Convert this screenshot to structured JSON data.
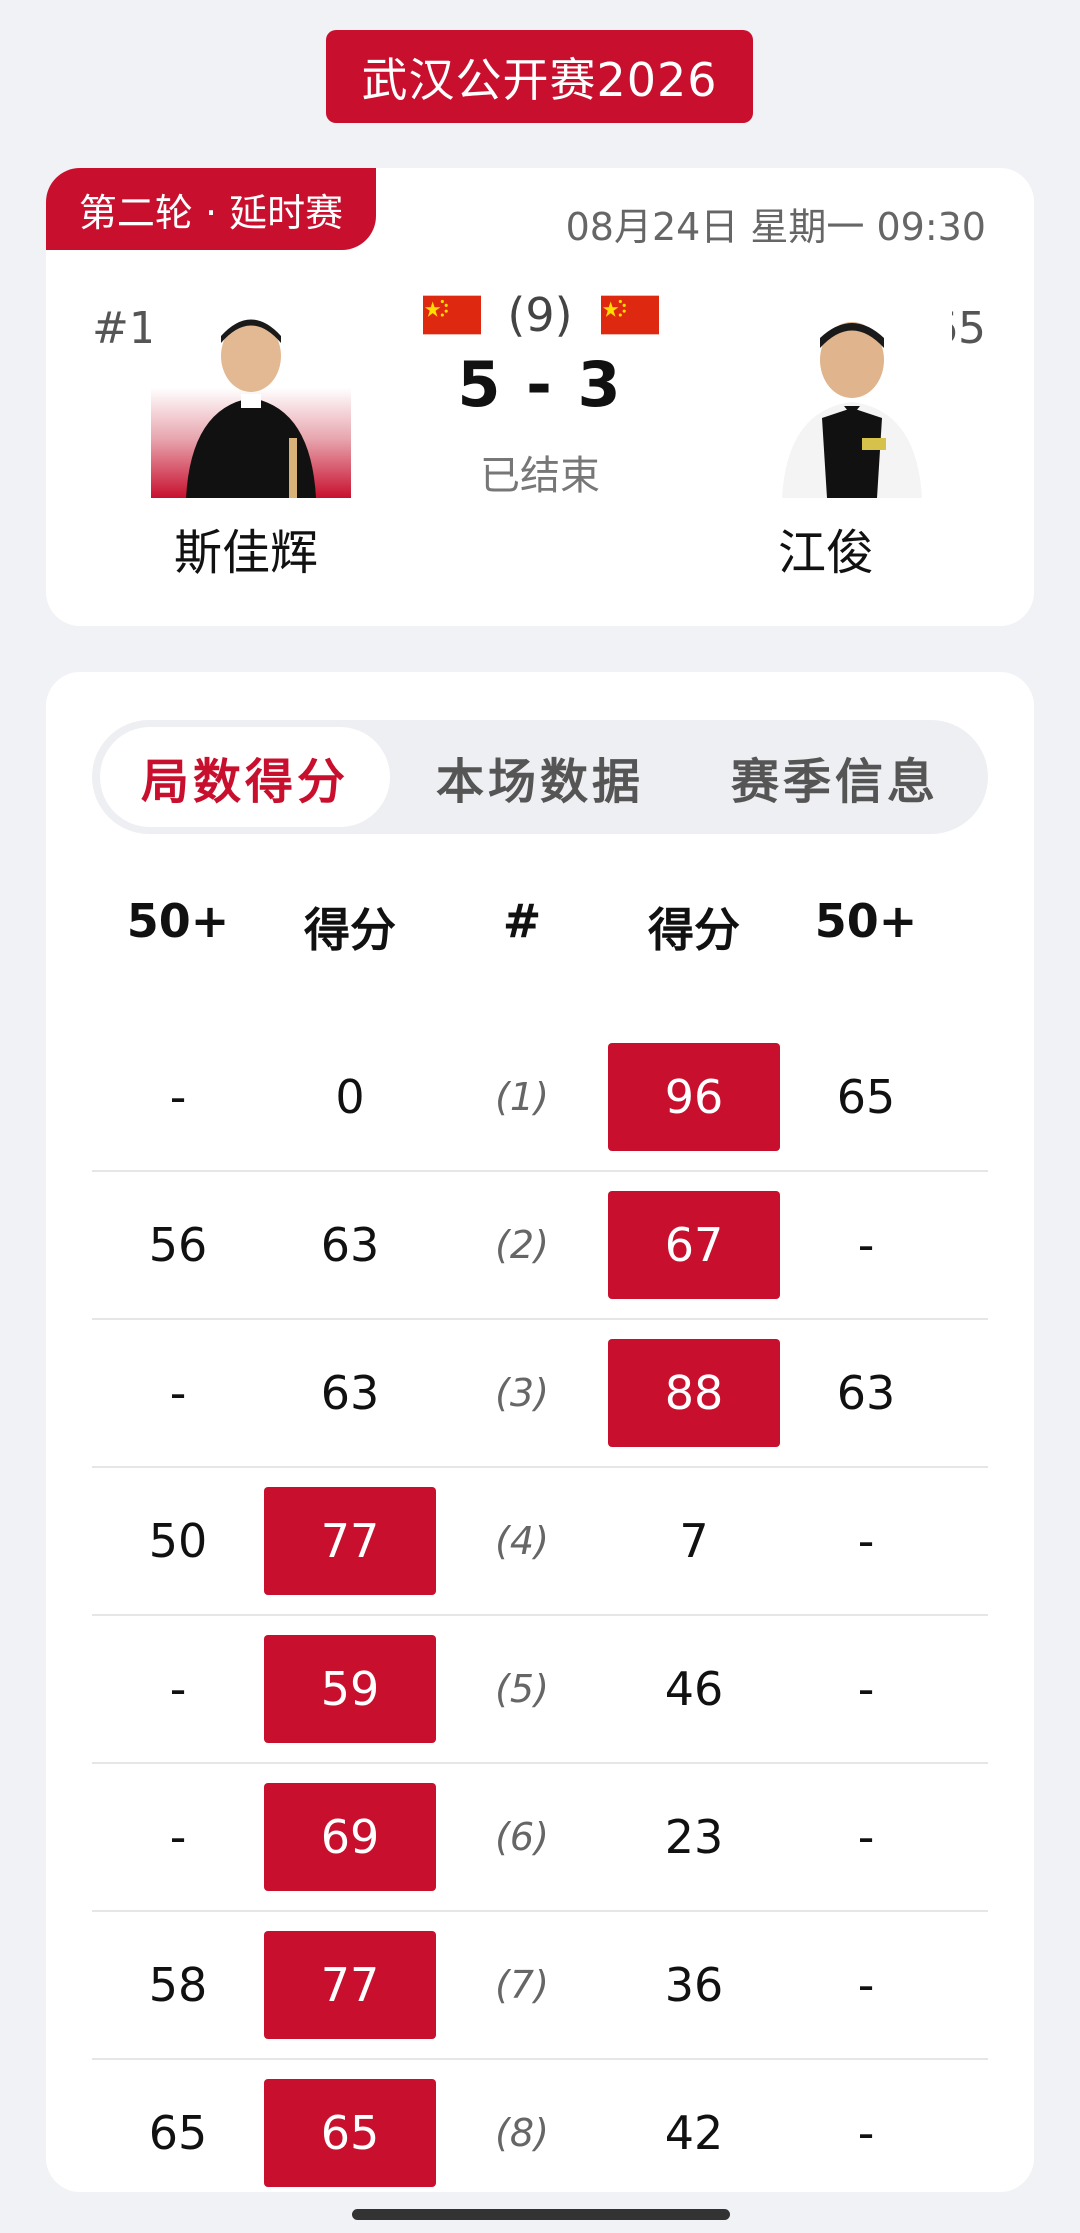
{
  "event_title": "武汉公开赛2026",
  "match": {
    "round": "第二轮 · 延时赛",
    "datetime": "08月24日 星期一 09:30",
    "best_of": "(9)",
    "score": "5 - 3",
    "status": "已结束",
    "player1": {
      "seed": "#16",
      "name": "斯佳辉"
    },
    "player2": {
      "seed": "#65",
      "name": "江俊"
    }
  },
  "tabs": [
    "局数得分",
    "本场数据",
    "赛季信息"
  ],
  "table": {
    "headers": [
      "50+",
      "得分",
      "#",
      "得分",
      "50+"
    ],
    "rows": [
      {
        "p1_break": "-",
        "p1_score": "0",
        "frame": "(1)",
        "p2_score": "96",
        "p2_break": "65",
        "winner": 2
      },
      {
        "p1_break": "56",
        "p1_score": "63",
        "frame": "(2)",
        "p2_score": "67",
        "p2_break": "-",
        "winner": 2
      },
      {
        "p1_break": "-",
        "p1_score": "63",
        "frame": "(3)",
        "p2_score": "88",
        "p2_break": "63",
        "winner": 2
      },
      {
        "p1_break": "50",
        "p1_score": "77",
        "frame": "(4)",
        "p2_score": "7",
        "p2_break": "-",
        "winner": 1
      },
      {
        "p1_break": "-",
        "p1_score": "59",
        "frame": "(5)",
        "p2_score": "46",
        "p2_break": "-",
        "winner": 1
      },
      {
        "p1_break": "-",
        "p1_score": "69",
        "frame": "(6)",
        "p2_score": "23",
        "p2_break": "-",
        "winner": 1
      },
      {
        "p1_break": "58",
        "p1_score": "77",
        "frame": "(7)",
        "p2_score": "36",
        "p2_break": "-",
        "winner": 1
      },
      {
        "p1_break": "65",
        "p1_score": "65",
        "frame": "(8)",
        "p2_score": "42",
        "p2_break": "-",
        "winner": 1
      }
    ]
  },
  "colors": {
    "accent": "#c8102e",
    "background": "#f1f2f5"
  }
}
